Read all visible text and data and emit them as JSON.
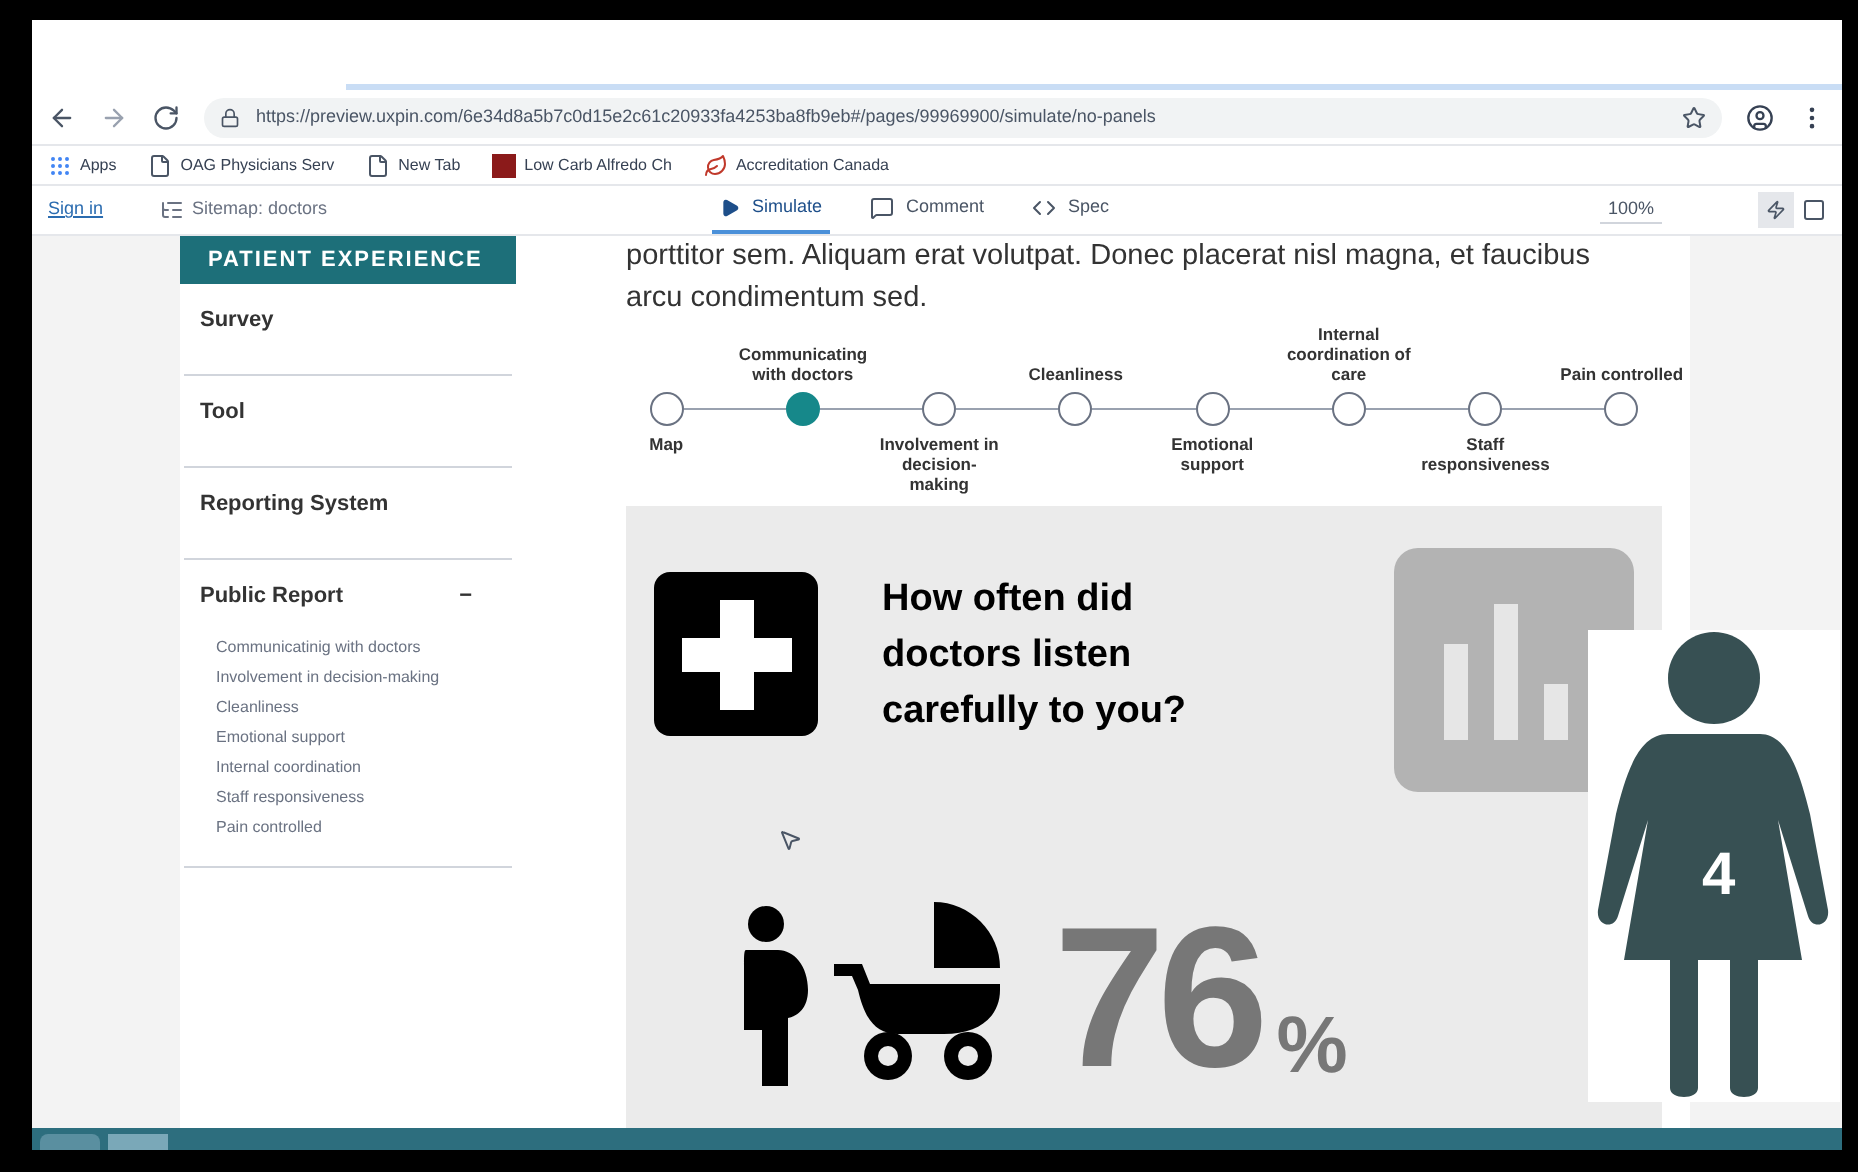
{
  "browser": {
    "url": "https://preview.uxpin.com/6e34d8a5b7c0d15e2c61c20933fa4253ba8fb9eb#/pages/99969900/simulate/no-panels",
    "bookmarks": [
      {
        "label": "Apps",
        "kind": "apps"
      },
      {
        "label": "OAG Physicians Serv",
        "kind": "page"
      },
      {
        "label": "New Tab",
        "kind": "page"
      },
      {
        "label": "Low Carb Alfredo Ch",
        "kind": "recipe"
      },
      {
        "label": "Accreditation Canada",
        "kind": "leaf"
      }
    ]
  },
  "toolbar": {
    "sign_in": "Sign in",
    "sitemap": "Sitemap: doctors",
    "tabs": [
      {
        "label": "Simulate",
        "kind": "play",
        "selected": true
      },
      {
        "label": "Comment",
        "kind": "comment",
        "selected": false
      },
      {
        "label": "Spec",
        "kind": "code",
        "selected": false
      }
    ],
    "zoom": "100%"
  },
  "sidebar": {
    "header": "PATIENT EXPERIENCE",
    "items": [
      {
        "label": "Survey"
      },
      {
        "label": "Tool"
      },
      {
        "label": "Reporting System"
      },
      {
        "label": "Public Report",
        "toggle": "−",
        "expanded": true,
        "children": [
          "Communicatinig with doctors",
          "Involvement in decision-making",
          "Cleanliness",
          "Emotional support",
          "Internal coordination",
          "Staff responsiveness",
          "Pain controlled"
        ]
      }
    ]
  },
  "intro": "porttitor sem.  Aliquam erat volutpat. Donec placerat nisl magna, et faucibus arcu condimentum sed.",
  "timeline": [
    {
      "label": "Map",
      "selected": false
    },
    {
      "label": "Communicating with doctors",
      "selected": true
    },
    {
      "label": "Involvement in decision-making",
      "selected": false
    },
    {
      "label": "Cleanliness",
      "selected": false
    },
    {
      "label": "Emotional support",
      "selected": false
    },
    {
      "label": "Internal coordination of care",
      "selected": false
    },
    {
      "label": "Staff responsiveness",
      "selected": false
    },
    {
      "label": "Pain controlled",
      "selected": false
    }
  ],
  "infographic": {
    "question": "How often did doctors listen carefully to you?",
    "value": "76",
    "unit": "%"
  },
  "overlay": {
    "number": "4"
  }
}
